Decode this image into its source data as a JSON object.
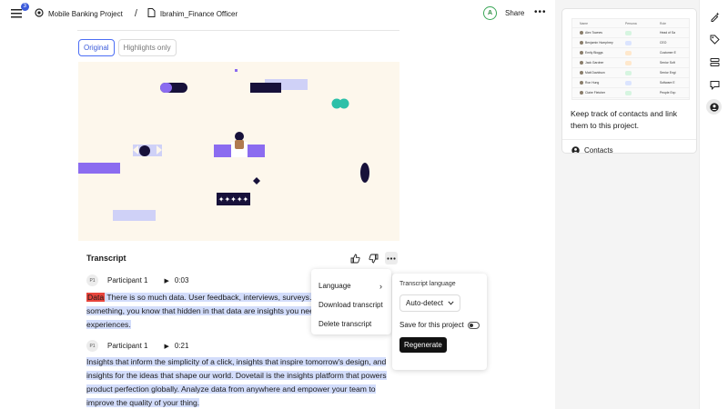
{
  "topbar": {
    "notification_count": "3",
    "project_name": "Mobile Banking Project",
    "separator": "/",
    "document_name": "Ibrahim_Finance Officer",
    "avatar_initial": "A",
    "share_label": "Share",
    "more_label": "•••"
  },
  "view_toggle": {
    "original_label": "Original",
    "highlights_label": "Highlights only"
  },
  "transcript": {
    "title": "Transcript",
    "segments": [
      {
        "speaker_initials": "P1",
        "speaker": "Participant 1",
        "timestamp": "0:03",
        "tag": "Data",
        "text": " There is so much data. User feedback, interviews, surveys… you're building something, you know that hidden in that data are insights you need to make great experiences."
      },
      {
        "speaker_initials": "P1",
        "speaker": "Participant 1",
        "timestamp": "0:21",
        "text_a": "Insights that inform the simplicity of a click, insights that inspire tomorrow's design, and insights for the ideas that shape our world.",
        "text_b": " Dovetail is the insights platform that powers product perfection globally. Analyze data from anywhere and empower your team to improve the quality of your thing."
      }
    ]
  },
  "context_menu": {
    "items": [
      "Language",
      "Download transcript",
      "Delete transcript"
    ]
  },
  "language_panel": {
    "title": "Transcript language",
    "selected": "Auto-detect",
    "save_label": "Save for this project",
    "save_enabled": false,
    "regenerate_label": "Regenerate"
  },
  "contacts_card": {
    "preview": {
      "headers": [
        "Name",
        "Persona",
        "Role"
      ],
      "rows": [
        {
          "name": "Alex Townes",
          "persona": "",
          "role": "Head of Sa",
          "pill": "#d6f5e0"
        },
        {
          "name": "Benjamin Humphrey",
          "persona": "",
          "role": "CEO",
          "pill": "#dbe4ff"
        },
        {
          "name": "Emily Bloggs",
          "persona": "",
          "role": "Customer E",
          "pill": "#ffe8cc"
        },
        {
          "name": "Jack Gardner",
          "persona": "",
          "role": "Senior Soft",
          "pill": "#ffe8cc"
        },
        {
          "name": "Matt Davidson",
          "persona": "",
          "role": "Senior Engi",
          "pill": "#d6f5e0"
        },
        {
          "name": "Ron Hung",
          "persona": "",
          "role": "Software E",
          "pill": "#dbe4ff"
        },
        {
          "name": "Claire Fletcher",
          "persona": "",
          "role": "People Exp",
          "pill": "#d6f5e0"
        }
      ]
    },
    "description": "Keep track of contacts and link them to this project.",
    "link_label": "Contacts"
  },
  "colors": {
    "accent": "#3b5bdb",
    "highlight": "#d3ddfb",
    "tag_red": "#e8453c",
    "illustration_bg": "#fdf7ec",
    "illustration_purple": "#8b6cf0",
    "illustration_lavender": "#cfd1f7",
    "illustration_navy": "#17113a",
    "illustration_teal": "#2cc0a8"
  },
  "rail_icons": [
    "sparkle-pen-icon",
    "tag-icon",
    "stack-icon",
    "comment-icon",
    "contact-icon"
  ]
}
